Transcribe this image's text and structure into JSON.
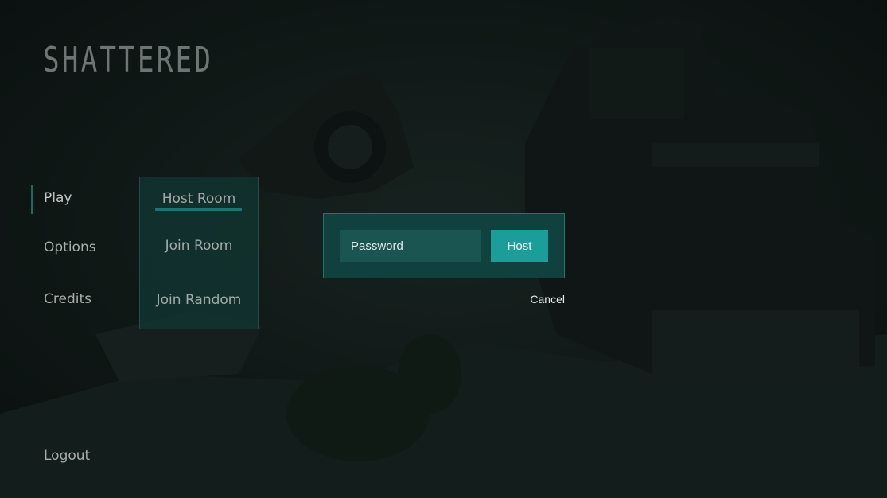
{
  "game": {
    "logo_text": "SHATTERED"
  },
  "main_menu": {
    "items": [
      {
        "label": "Play",
        "active": true
      },
      {
        "label": "Options",
        "active": false
      },
      {
        "label": "Credits",
        "active": false
      }
    ],
    "logout_label": "Logout"
  },
  "play_submenu": {
    "items": [
      {
        "label": "Host Room",
        "selected": true
      },
      {
        "label": "Join Room",
        "selected": false
      },
      {
        "label": "Join Random",
        "selected": false
      }
    ]
  },
  "host_dialog": {
    "password_placeholder": "Password",
    "password_value": "",
    "host_label": "Host",
    "cancel_label": "Cancel"
  },
  "colors": {
    "accent": "#1b9d9a",
    "panel": "#10413f",
    "background": "#0d1413"
  }
}
